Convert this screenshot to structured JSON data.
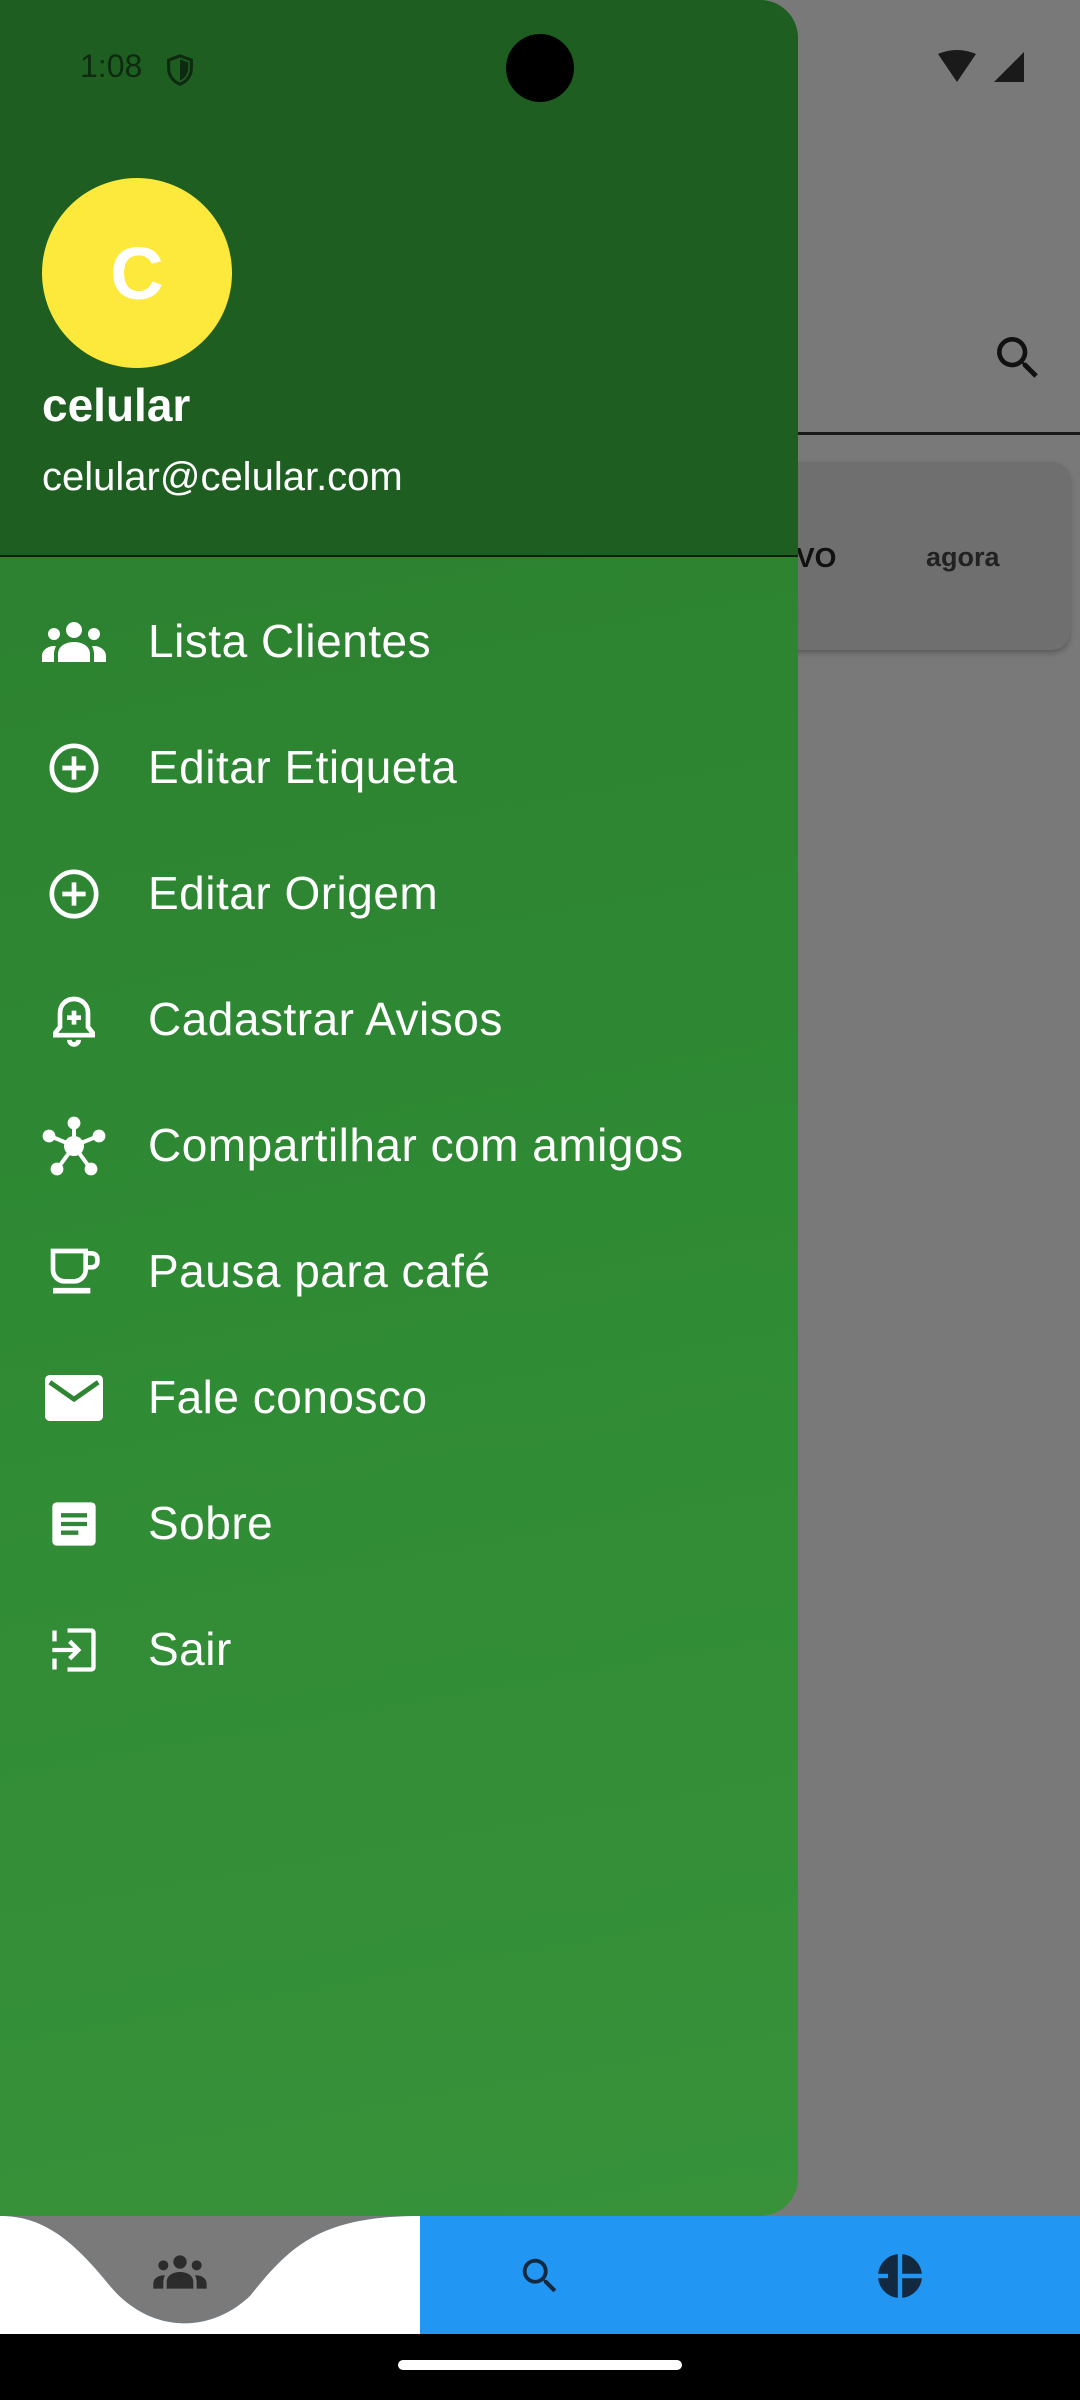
{
  "status_bar": {
    "time": "1:08"
  },
  "background": {
    "card": {
      "status_text": "VO",
      "time_text": "agora"
    }
  },
  "drawer": {
    "header": {
      "avatar_letter": "C",
      "user_name": "celular",
      "user_email": "celular@celular.com",
      "header_color": "#1E5F21",
      "avatar_color": "#FDE93B"
    },
    "items": [
      {
        "label": "Lista Clientes",
        "icon": "people-group-icon"
      },
      {
        "label": "Editar Etiqueta",
        "icon": "add-circle-outline-icon"
      },
      {
        "label": "Editar Origem",
        "icon": "add-circle-outline-icon"
      },
      {
        "label": "Cadastrar Avisos",
        "icon": "notification-add-icon"
      },
      {
        "label": "Compartilhar com amigos",
        "icon": "share-hub-icon"
      },
      {
        "label": "Pausa para café",
        "icon": "coffee-cup-icon"
      },
      {
        "label": "Fale conosco",
        "icon": "email-icon"
      },
      {
        "label": "Sobre",
        "icon": "article-icon"
      },
      {
        "label": "Sair",
        "icon": "logout-icon"
      }
    ]
  },
  "bottom_nav": {
    "color": "#2196F3",
    "items": [
      {
        "icon": "people-group-icon",
        "selected": true
      },
      {
        "icon": "search-icon",
        "selected": false
      },
      {
        "icon": "pie-chart-icon",
        "selected": false
      }
    ]
  }
}
